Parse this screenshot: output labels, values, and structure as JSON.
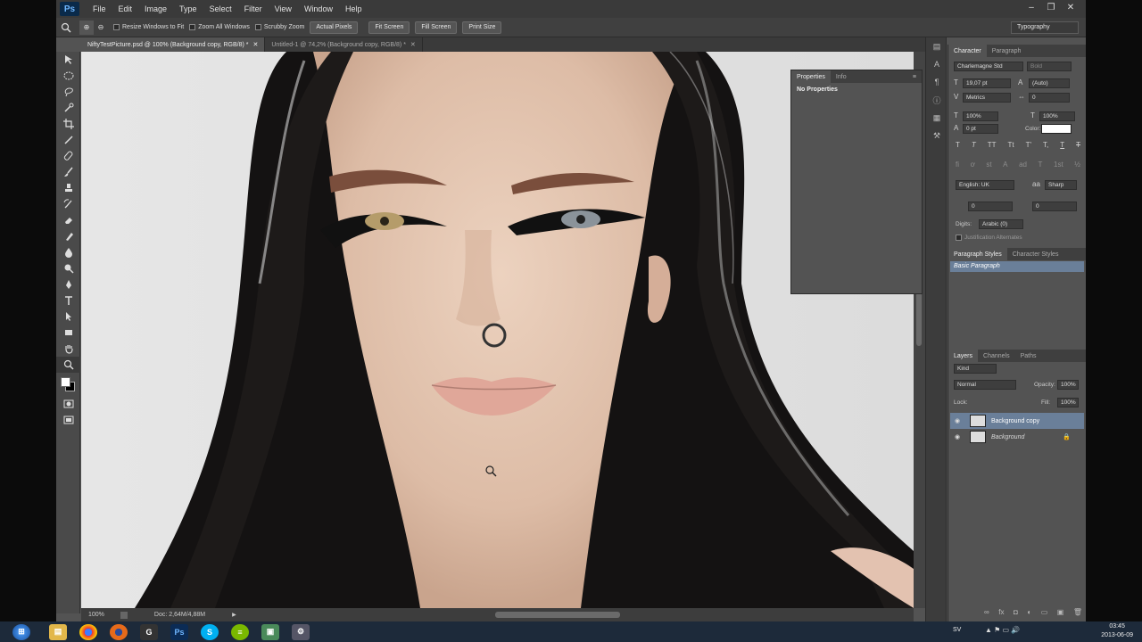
{
  "menu": {
    "logo": "Ps",
    "items": [
      "File",
      "Edit",
      "Image",
      "Type",
      "Select",
      "Filter",
      "View",
      "Window",
      "Help"
    ]
  },
  "options_bar": {
    "resize_windows": "Resize Windows to Fit",
    "zoom_all": "Zoom All Windows",
    "scrubby_zoom": "Scrubby Zoom",
    "actual_pixels": "Actual Pixels",
    "fit_screen": "Fit Screen",
    "fill_screen": "Fill Screen",
    "print_size": "Print Size",
    "workspace": "Typography"
  },
  "doc_tabs": [
    {
      "label": "NiftyTestPicture.psd @ 100% (Background copy, RGB/8) *"
    },
    {
      "label": "Untitled-1 @ 74,2% (Background copy, RGB/8) *"
    }
  ],
  "status": {
    "zoom": "100%",
    "doc": "Doc: 2,64M/4,88M"
  },
  "properties_panel": {
    "tab_properties": "Properties",
    "tab_info": "Info",
    "content": "No Properties"
  },
  "character_panel": {
    "tab_character": "Character",
    "tab_paragraph": "Paragraph",
    "font_family": "Charlemagne Std",
    "font_style": "Bold",
    "font_size": "19,07 pt",
    "leading": "(Auto)",
    "kerning": "Metrics",
    "tracking": "0",
    "vscale": "100%",
    "hscale": "100%",
    "baseline": "0 pt",
    "color_label": "Color:",
    "language": "English: UK",
    "antialias": "Sharp",
    "kern_a": "0",
    "kern_b": "0",
    "digits_label": "Digits:",
    "digits_value": "Arabic (0)",
    "justification": "Justification Alternates",
    "type_buttons": [
      "T",
      "T",
      "TT",
      "Tt",
      "T'",
      "T,",
      "T",
      "T"
    ],
    "ot_buttons": [
      "fi",
      "ơ",
      "st",
      "A",
      "ad",
      "T",
      "1st",
      "½"
    ]
  },
  "styles_panel": {
    "tab_paragraph_styles": "Paragraph Styles",
    "tab_character_styles": "Character Styles",
    "selected_style": "Basic Paragraph"
  },
  "layers_panel": {
    "tab_layers": "Layers",
    "tab_channels": "Channels",
    "tab_paths": "Paths",
    "kind": "Kind",
    "blend_mode": "Normal",
    "opacity_label": "Opacity:",
    "opacity": "100%",
    "lock_label": "Lock:",
    "fill_label": "Fill:",
    "fill": "100%",
    "layers": [
      {
        "name": "Background copy",
        "selected": true
      },
      {
        "name": "Background",
        "selected": false,
        "locked": true
      }
    ]
  },
  "taskbar": {
    "apps": [
      "windows-start",
      "explorer",
      "chrome",
      "firefox",
      "google",
      "photoshop",
      "skype",
      "spotify",
      "notepad",
      "tool"
    ],
    "lang": "SV",
    "time": "03:45",
    "date": "2013-06-09"
  },
  "colors": {
    "ps_bg": "#535353",
    "panel_dark": "#3a3a3a",
    "selection": "#6a7f99"
  }
}
